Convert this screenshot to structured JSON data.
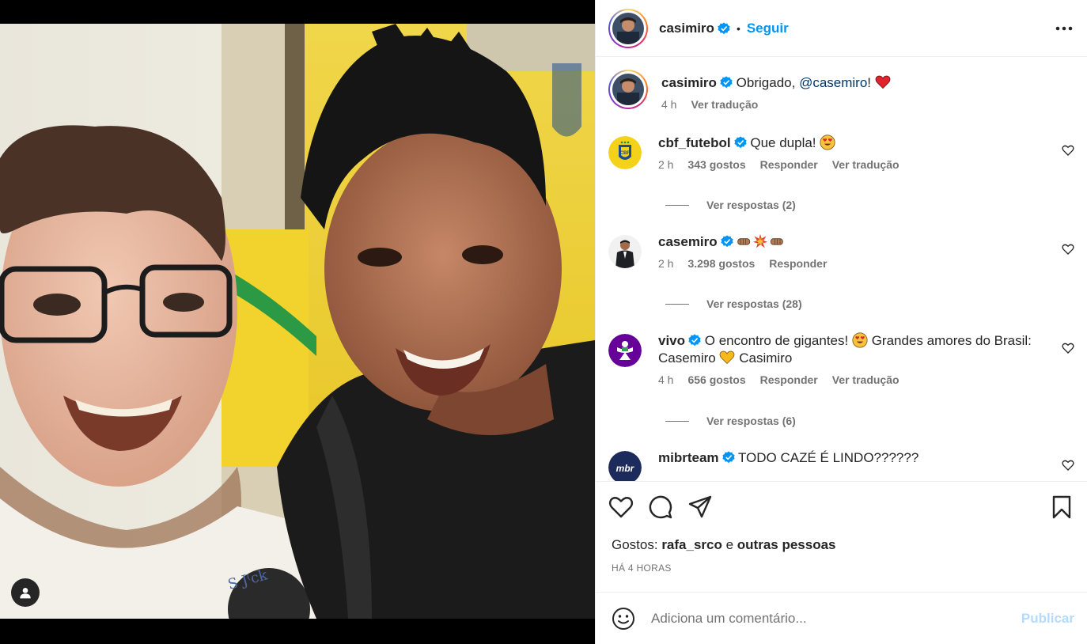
{
  "header": {
    "username": "casimiro",
    "dot": "•",
    "follow_label": "Seguir"
  },
  "caption": {
    "username": "casimiro",
    "text_prefix": "Obrigado, ",
    "mention": "@casemiro",
    "text_suffix": "!",
    "time": "4 h",
    "translate": "Ver tradução"
  },
  "comments": [
    {
      "username": "cbf_futebol",
      "text": "Que dupla!",
      "time": "2 h",
      "likes": "343 gostos",
      "reply": "Responder",
      "translate": "Ver tradução",
      "replies": "Ver respostas (2)"
    },
    {
      "username": "casemiro",
      "text": "",
      "time": "2 h",
      "likes": "3.298 gostos",
      "reply": "Responder",
      "replies": "Ver respostas (28)"
    },
    {
      "username": "vivo",
      "text_a": "O encontro de gigantes!",
      "text_b": "Grandes amores do Brasil: Casemiro",
      "text_c": "Casimiro",
      "time": "4 h",
      "likes": "656 gostos",
      "reply": "Responder",
      "translate": "Ver tradução",
      "replies": "Ver respostas (6)"
    },
    {
      "username": "mibrteam",
      "text": "TODO CAZÉ É LINDO??????",
      "avatar_text": "mbr"
    }
  ],
  "likes_section": {
    "prefix": "Gostos: ",
    "first_user": "rafa_srco",
    "connector": " e ",
    "others": "outras pessoas",
    "posted": "HÁ 4 HORAS"
  },
  "composer": {
    "placeholder": "Adiciona um comentário...",
    "publish_label": "Publicar"
  },
  "colors": {
    "accent_blue": "#0095f6",
    "verified_blue": "#0095f6",
    "publish_disabled": "#b3dbff",
    "secondary_text": "#737373"
  },
  "icons": [
    "verified-badge-icon",
    "more-options-icon",
    "heart-icon",
    "comment-icon",
    "share-icon",
    "bookmark-icon",
    "emoji-icon",
    "user-tag-icon"
  ]
}
